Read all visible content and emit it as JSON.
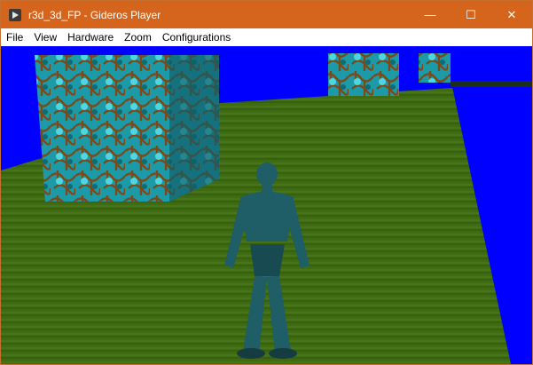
{
  "window": {
    "title": "r3d_3d_FP - Gideros Player",
    "controls": {
      "minimize": "—",
      "maximize": "☐",
      "close": "✕"
    }
  },
  "menu": {
    "items": [
      "File",
      "View",
      "Hardware",
      "Zoom",
      "Configurations"
    ]
  },
  "scene": {
    "sky_color": "#0000ff",
    "ground_color": "#3f6b12",
    "cube_color": "#2aa7b0",
    "character_color": "#1f5d67"
  }
}
